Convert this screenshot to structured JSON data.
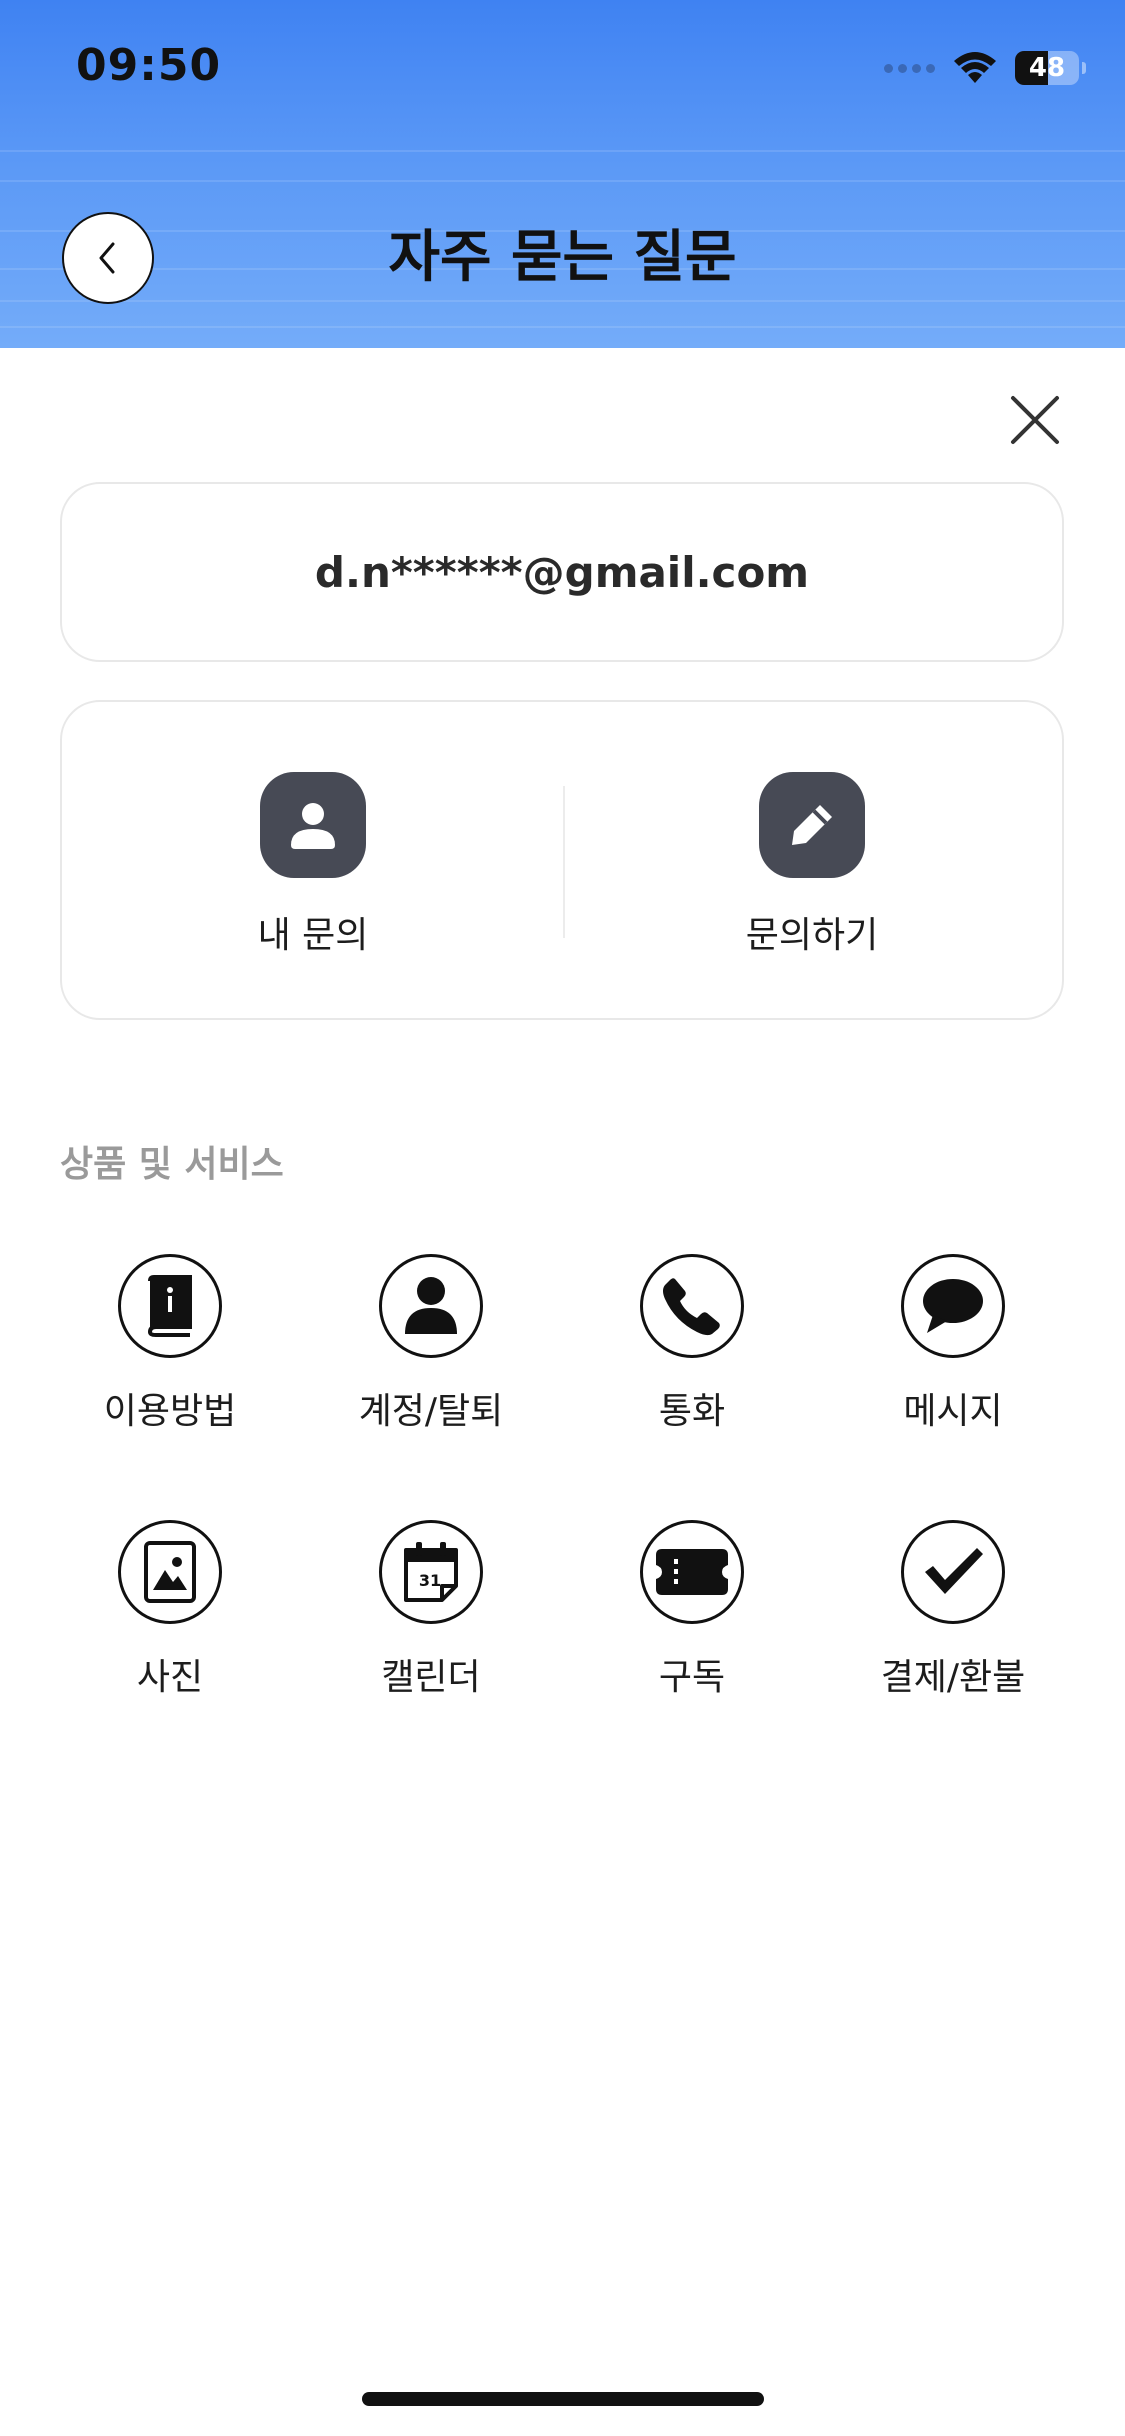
{
  "status_bar": {
    "time": "09:50",
    "battery": "48",
    "icons": [
      "signal-dots-icon",
      "wifi-icon",
      "battery-icon"
    ]
  },
  "header": {
    "title": "자주 묻는 질문",
    "back_icon": "chevron-left-icon",
    "background": "#4f8ff5"
  },
  "close_icon": "close-icon",
  "account": {
    "email": "d.n******@gmail.com"
  },
  "actions": [
    {
      "label": "내 문의",
      "icon": "person-icon"
    },
    {
      "label": "문의하기",
      "icon": "pencil-icon"
    }
  ],
  "section": {
    "title": "상품 및 서비스",
    "items": [
      {
        "label": "이용방법",
        "icon": "guide-book-icon"
      },
      {
        "label": "계정/탈퇴",
        "icon": "account-person-icon"
      },
      {
        "label": "통화",
        "icon": "phone-icon"
      },
      {
        "label": "메시지",
        "icon": "message-bubble-icon"
      },
      {
        "label": "사진",
        "icon": "photo-icon"
      },
      {
        "label": "캘린더",
        "icon": "calendar-icon"
      },
      {
        "label": "구독",
        "icon": "ticket-icon"
      },
      {
        "label": "결제/환불",
        "icon": "checkmark-icon"
      }
    ]
  },
  "calendar_day": "31"
}
